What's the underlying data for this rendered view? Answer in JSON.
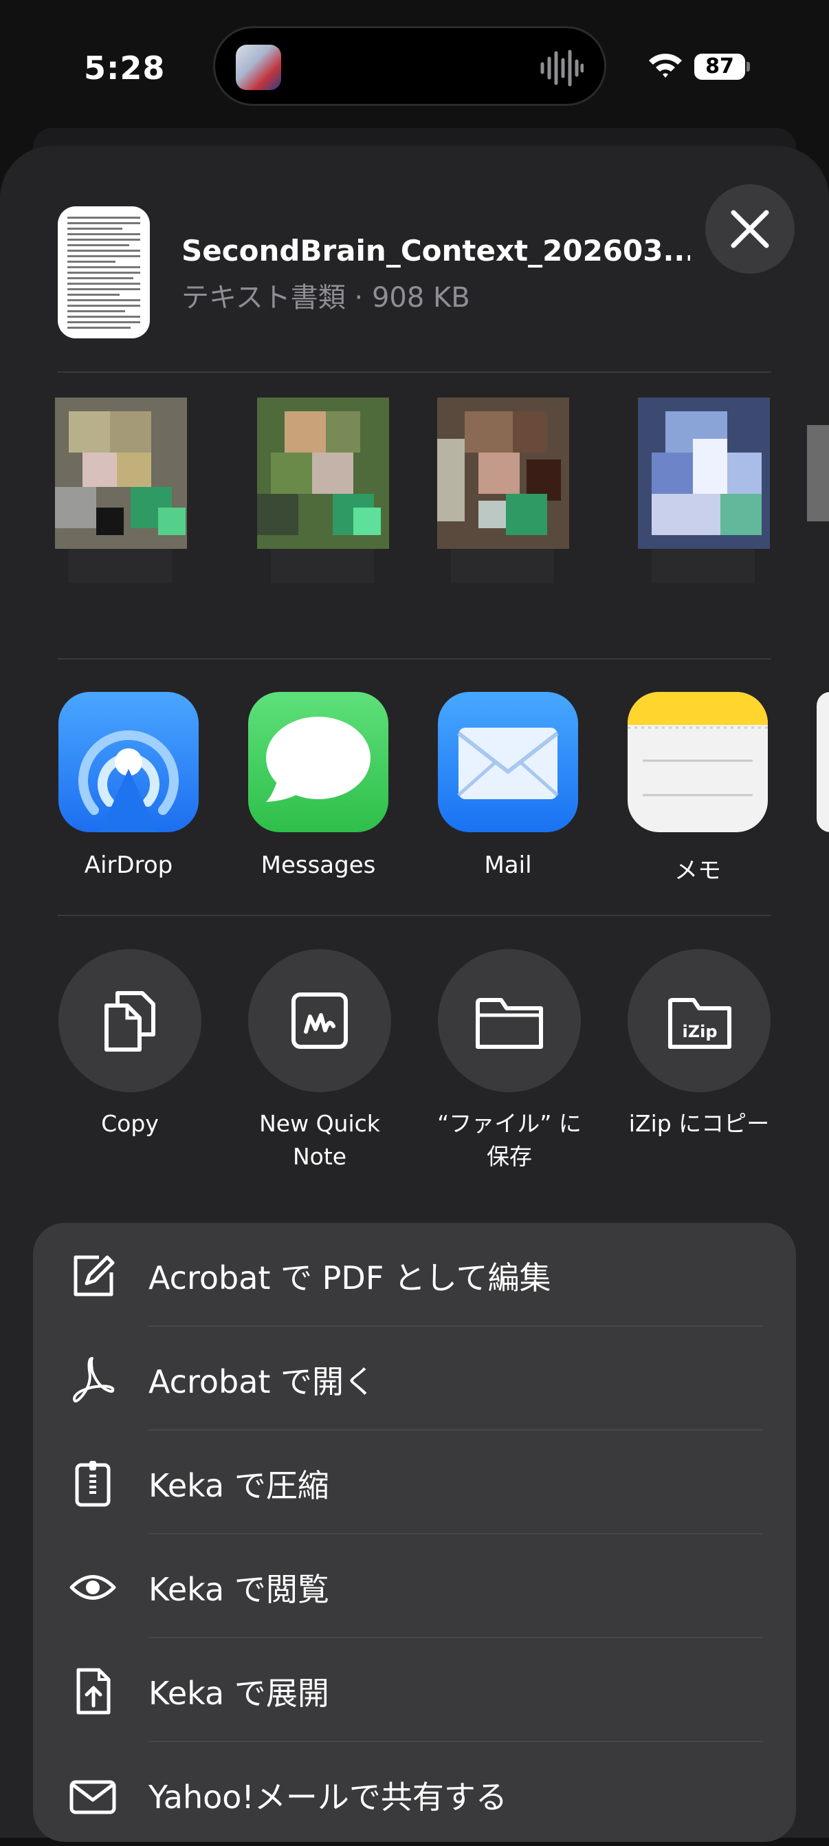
{
  "status_bar": {
    "time": "5:28",
    "battery": "87",
    "icons": [
      "app-thumbnail-icon",
      "voice-waveform-icon",
      "wifi-icon",
      "battery-icon"
    ]
  },
  "share_header": {
    "file_name": "SecondBrain_Context_202603...",
    "file_meta": "テキスト書類 · 908 KB",
    "close_icon": "close-icon"
  },
  "apps": [
    {
      "label": "AirDrop",
      "icon": "airdrop-icon",
      "color": "#1e88f5"
    },
    {
      "label": "Messages",
      "icon": "messages-icon",
      "color": "#34c759"
    },
    {
      "label": "Mail",
      "icon": "mail-icon",
      "color": "#1a82fb"
    },
    {
      "label": "メモ",
      "icon": "notes-icon",
      "color": "#ffd52e"
    }
  ],
  "actions": [
    {
      "label": "Copy",
      "icon": "copy-icon"
    },
    {
      "label": "New Quick\nNote",
      "icon": "quick-note-icon"
    },
    {
      "label": "“ファイル” に\n保存",
      "icon": "folder-icon"
    },
    {
      "label": "iZip にコピー",
      "icon": "izip-folder-icon",
      "icon_text": "iZip"
    }
  ],
  "menu": [
    {
      "label": "Acrobat で PDF として編集",
      "icon": "edit-pencil-icon"
    },
    {
      "label": "Acrobat で開く",
      "icon": "acrobat-icon"
    },
    {
      "label": "Keka で圧縮",
      "icon": "zip-archive-icon"
    },
    {
      "label": "Keka で閲覧",
      "icon": "eye-icon"
    },
    {
      "label": "Keka で展開",
      "icon": "extract-document-icon"
    },
    {
      "label": "Yahoo!メールで共有する",
      "icon": "envelope-icon"
    }
  ]
}
